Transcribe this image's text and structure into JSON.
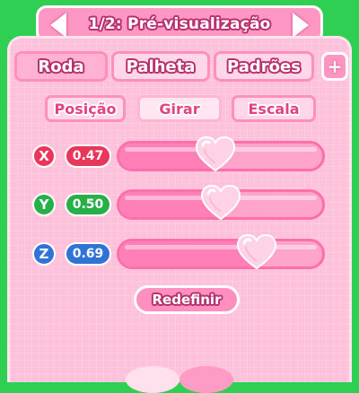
{
  "title": {
    "text": "1/2: Pré-visualização"
  },
  "tabs": [
    {
      "label": "Roda"
    },
    {
      "label": "Palheta"
    },
    {
      "label": "Padrões"
    }
  ],
  "plus_label": "+",
  "subtabs": [
    {
      "label": "Posição"
    },
    {
      "label": "Girar"
    },
    {
      "label": "Escala"
    }
  ],
  "axes": [
    {
      "label": "X",
      "value": "0.47",
      "level": 0.47,
      "color": "#e8375a"
    },
    {
      "label": "Y",
      "value": "0.50",
      "level": 0.5,
      "color": "#27b04a"
    },
    {
      "label": "Z",
      "value": "0.69",
      "level": 0.69,
      "color": "#2e74d6"
    }
  ],
  "reset_label": "Redefinir",
  "colors": {
    "accent": "#ff8fbf",
    "panel": "#ffc1da",
    "background": "#2ecf52"
  }
}
